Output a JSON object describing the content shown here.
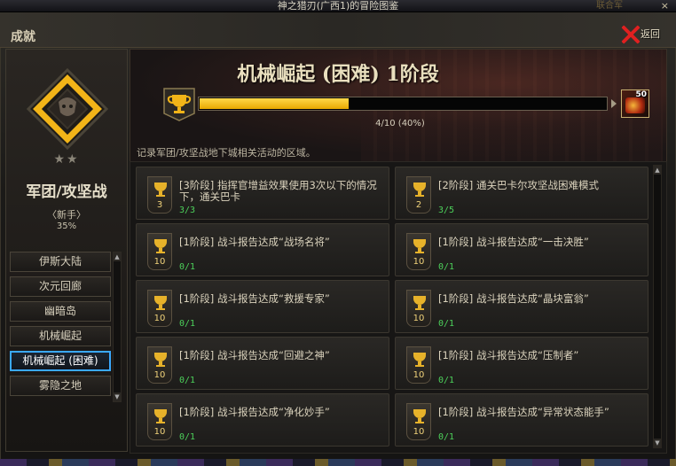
{
  "window": {
    "title": "神之猎刃(广西1)的冒险图鉴",
    "close_glyph": "×",
    "ghost_text": "联合军"
  },
  "panel": {
    "title": "成就",
    "back_label": "返回",
    "back_label_2": "返回"
  },
  "category": {
    "stars": "★★",
    "name": "军团/攻坚战",
    "rank": "〈新手〉",
    "percent": "35%"
  },
  "nav": {
    "items": [
      {
        "label": "伊斯大陆"
      },
      {
        "label": "次元回廊"
      },
      {
        "label": "幽暗岛"
      },
      {
        "label": "机械崛起"
      },
      {
        "label": "机械崛起 (困难)"
      },
      {
        "label": "雾隐之地"
      }
    ],
    "active_index": 4
  },
  "achievement": {
    "title": "机械崛起 (困难) 1阶段",
    "progress_text": "4/10 (40%)",
    "progress_fraction": 0.4,
    "reward_qty": "50",
    "description": "记录军团/攻坚战地下城相关活动的区域。"
  },
  "cards": [
    {
      "text": "[3阶段] 指挥官增益效果使用3次以下的情况下，通关巴卡",
      "points": "3",
      "progress": "3/3"
    },
    {
      "text": "[2阶段] 通关巴卡尔攻坚战困难模式",
      "points": "2",
      "progress": "3/5"
    },
    {
      "text": "[1阶段] 战斗报告达成“战场名将”",
      "points": "10",
      "progress": "0/1"
    },
    {
      "text": "[1阶段] 战斗报告达成“一击决胜”",
      "points": "10",
      "progress": "0/1"
    },
    {
      "text": "[1阶段] 战斗报告达成“救援专家”",
      "points": "10",
      "progress": "0/1"
    },
    {
      "text": "[1阶段] 战斗报告达成“晶块富翁”",
      "points": "10",
      "progress": "0/1"
    },
    {
      "text": "[1阶段] 战斗报告达成“回避之神”",
      "points": "10",
      "progress": "0/1"
    },
    {
      "text": "[1阶段] 战斗报告达成“压制者”",
      "points": "10",
      "progress": "0/1"
    },
    {
      "text": "[1阶段] 战斗报告达成“净化妙手”",
      "points": "10",
      "progress": "0/1"
    },
    {
      "text": "[1阶段] 战斗报告达成“异常状态能手”",
      "points": "10",
      "progress": "0/1"
    }
  ],
  "colors": {
    "accent_gold": "#e7b22a",
    "progress_green": "#4ccf5a",
    "active_nav_border": "#3aa9ff",
    "close_red": "#e02020"
  }
}
